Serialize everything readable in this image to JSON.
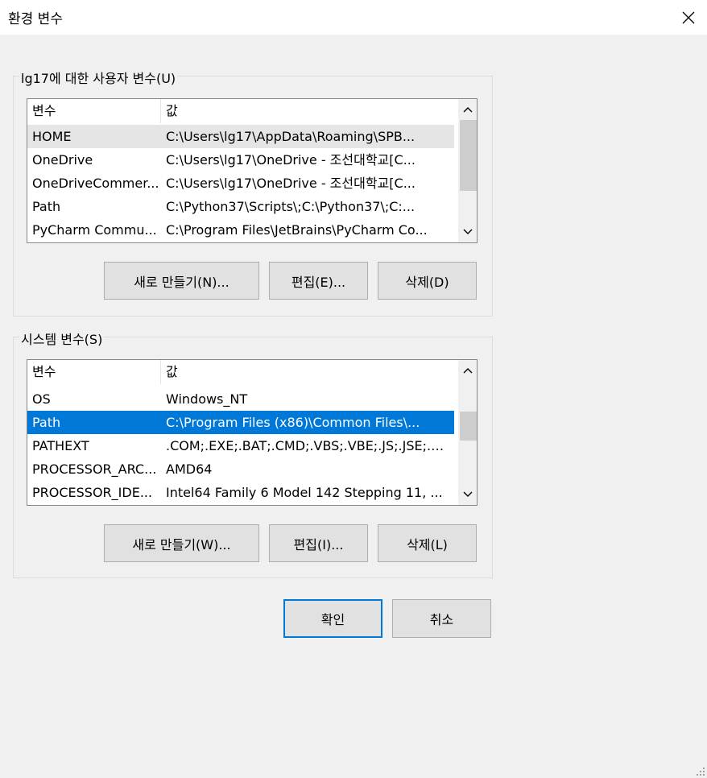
{
  "window": {
    "title": "환경 변수"
  },
  "user_section": {
    "label": "lg17에 대한 사용자 변수(U)",
    "columns": [
      "변수",
      "값"
    ],
    "rows": [
      {
        "name": "HOME",
        "value": "C:\\Users\\lg17\\AppData\\Roaming\\SPB..."
      },
      {
        "name": "OneDrive",
        "value": "C:\\Users\\lg17\\OneDrive - 조선대학교[C..."
      },
      {
        "name": "OneDriveCommer...",
        "value": "C:\\Users\\lg17\\OneDrive - 조선대학교[C..."
      },
      {
        "name": "Path",
        "value": "C:\\Python37\\Scripts\\;C:\\Python37\\;C:..."
      },
      {
        "name": "PyCharm Commu...",
        "value": "C:\\Program Files\\JetBrains\\PyCharm Co..."
      }
    ],
    "buttons": {
      "new": "새로 만들기(N)...",
      "edit": "편집(E)...",
      "delete": "삭제(D)"
    }
  },
  "system_section": {
    "label": "시스템 변수(S)",
    "columns": [
      "변수",
      "값"
    ],
    "rows": [
      {
        "name": "OS",
        "value": "Windows_NT"
      },
      {
        "name": "Path",
        "value": "C:\\Program Files (x86)\\Common Files\\..."
      },
      {
        "name": "PATHEXT",
        "value": ".COM;.EXE;.BAT;.CMD;.VBS;.VBE;.JS;.JSE;.W..."
      },
      {
        "name": "PROCESSOR_ARC...",
        "value": "AMD64"
      },
      {
        "name": "PROCESSOR_IDE...",
        "value": "Intel64 Family 6 Model 142 Stepping 11, ..."
      }
    ],
    "buttons": {
      "new": "새로 만들기(W)...",
      "edit": "편집(I)...",
      "delete": "삭제(L)"
    }
  },
  "footer": {
    "ok": "확인",
    "cancel": "취소"
  },
  "colors": {
    "selection": "#0078d7",
    "hover_row": "#e5e5e5",
    "button_face": "#e1e1e1"
  }
}
